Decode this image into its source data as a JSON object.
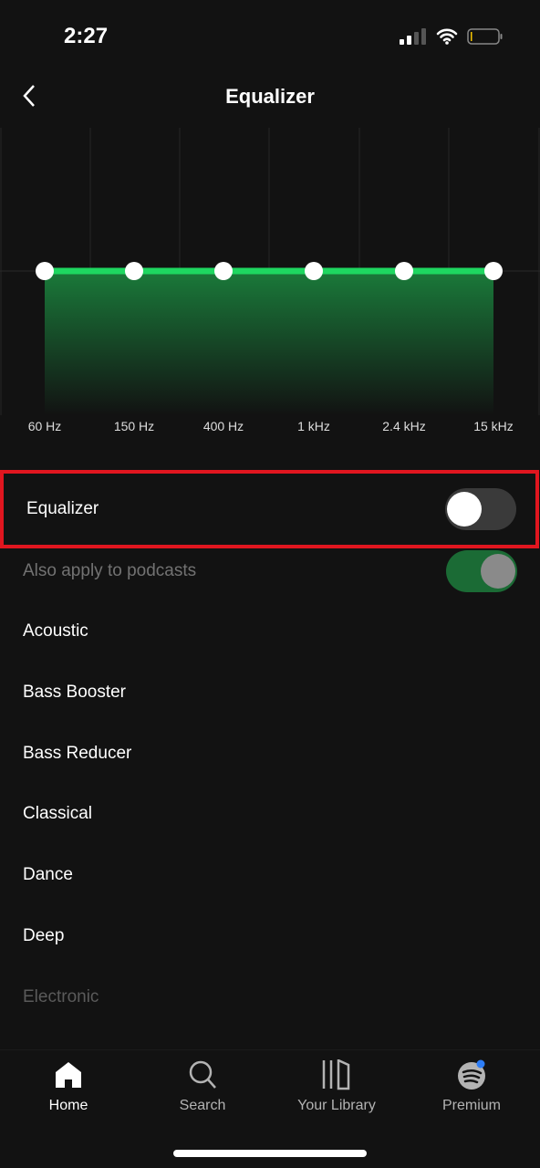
{
  "status": {
    "time": "2:27"
  },
  "header": {
    "title": "Equalizer"
  },
  "equalizer": {
    "bands": [
      {
        "label": "60 Hz",
        "gain": 0
      },
      {
        "label": "150 Hz",
        "gain": 0
      },
      {
        "label": "400 Hz",
        "gain": 0
      },
      {
        "label": "1 kHz",
        "gain": 0
      },
      {
        "label": "2.4 kHz",
        "gain": 0
      },
      {
        "label": "15 kHz",
        "gain": 0
      }
    ],
    "line_color": "#1ed760"
  },
  "settings": {
    "equalizer": {
      "label": "Equalizer",
      "enabled": false
    },
    "podcasts": {
      "label": "Also apply to podcasts",
      "enabled": true
    }
  },
  "presets": [
    "Acoustic",
    "Bass Booster",
    "Bass Reducer",
    "Classical",
    "Dance",
    "Deep",
    "Electronic"
  ],
  "nav": [
    {
      "label": "Home",
      "icon": "home-icon"
    },
    {
      "label": "Search",
      "icon": "search-icon"
    },
    {
      "label": "Your Library",
      "icon": "library-icon"
    },
    {
      "label": "Premium",
      "icon": "spotify-icon"
    }
  ]
}
